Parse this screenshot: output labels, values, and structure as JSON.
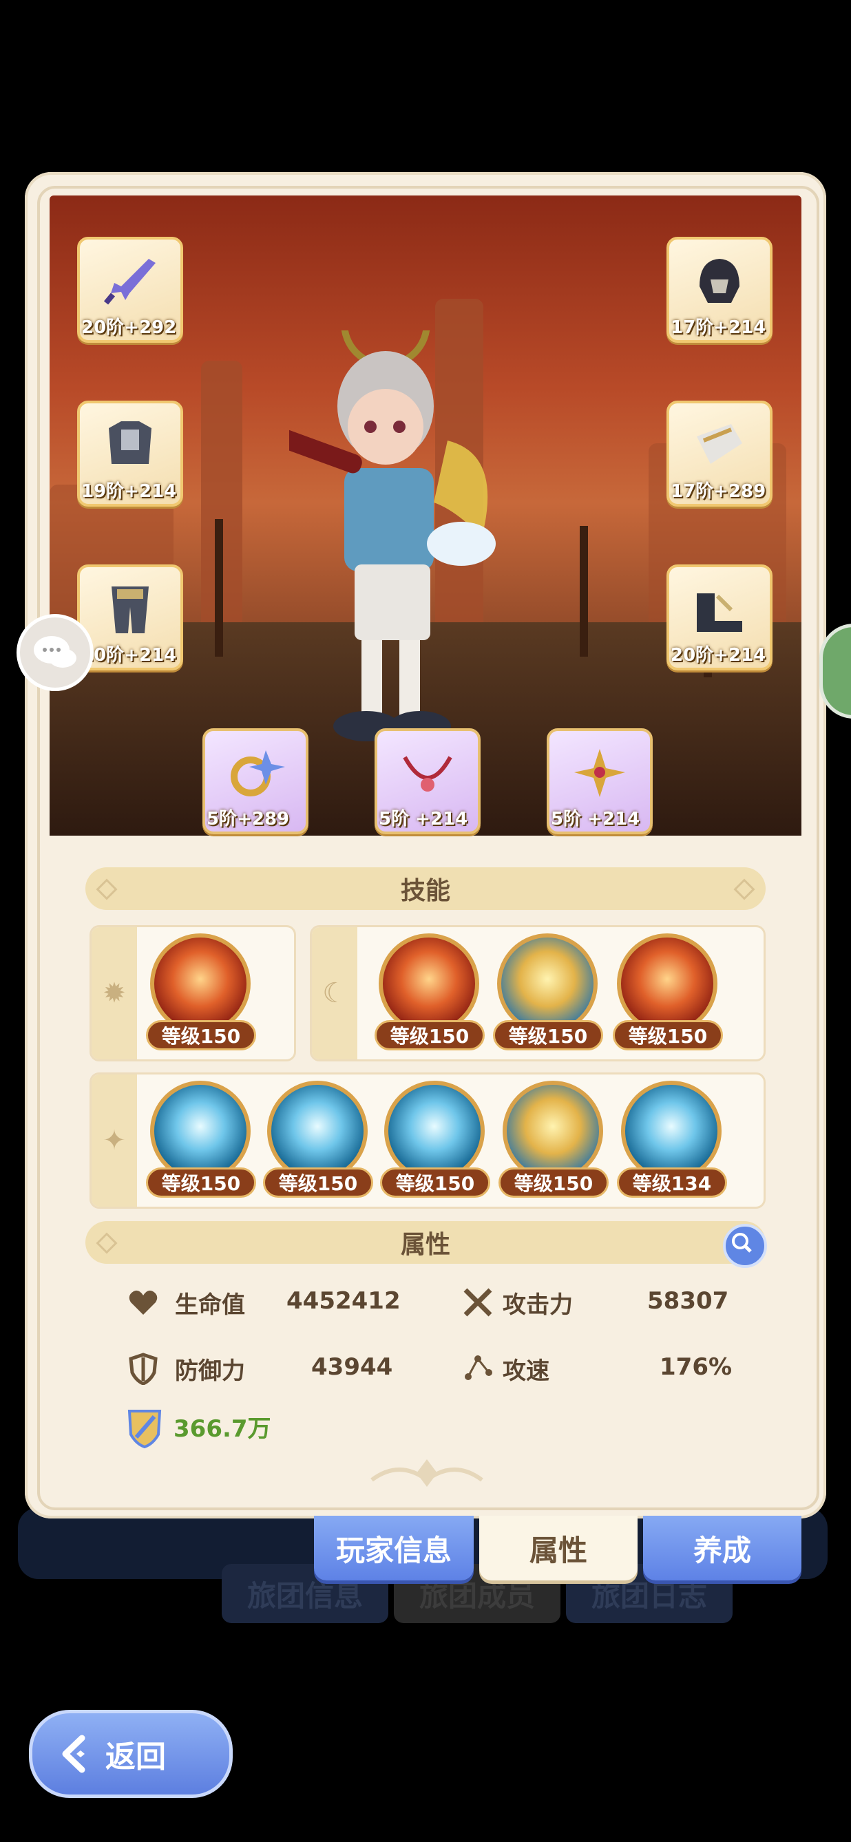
{
  "background_tabs": [
    "旅团信息",
    "旅团成员",
    "旅团日志"
  ],
  "equipment": {
    "left": [
      {
        "name": "sword",
        "level": "20阶+292"
      },
      {
        "name": "chest-armor",
        "level": "19阶+214"
      },
      {
        "name": "leg-armor",
        "level": "20阶+214"
      }
    ],
    "right": [
      {
        "name": "helmet",
        "level": "17阶+214"
      },
      {
        "name": "gauntlets",
        "level": "17阶+289"
      },
      {
        "name": "boots",
        "level": "20阶+214"
      }
    ],
    "accessories": [
      {
        "name": "ring",
        "level": "5阶+289"
      },
      {
        "name": "necklace",
        "level": "5阶 +214"
      },
      {
        "name": "amulet",
        "level": "5阶 +214"
      }
    ]
  },
  "skills": {
    "header": "技能",
    "row1_left": [
      "等级150"
    ],
    "row1_right": [
      "等级150",
      "等级150",
      "等级150"
    ],
    "row2": [
      "等级150",
      "等级150",
      "等级150",
      "等级150",
      "等级134"
    ]
  },
  "attributes": {
    "header": "属性",
    "hp_label": "生命值",
    "hp_value": "4452412",
    "atk_label": "攻击力",
    "atk_value": "58307",
    "def_label": "防御力",
    "def_value": "43944",
    "spd_label": "攻速",
    "spd_value": "176%",
    "power_value": "366.7万"
  },
  "tabs": {
    "player_info": "玩家信息",
    "attributes": "属性",
    "training": "养成"
  },
  "back_button": "返回",
  "colors": {
    "panel": "#f7efe1",
    "tab_blue": "#5e82e6",
    "power_green": "#5a9a2e",
    "skill_level_bg": "#8a3e1a"
  }
}
